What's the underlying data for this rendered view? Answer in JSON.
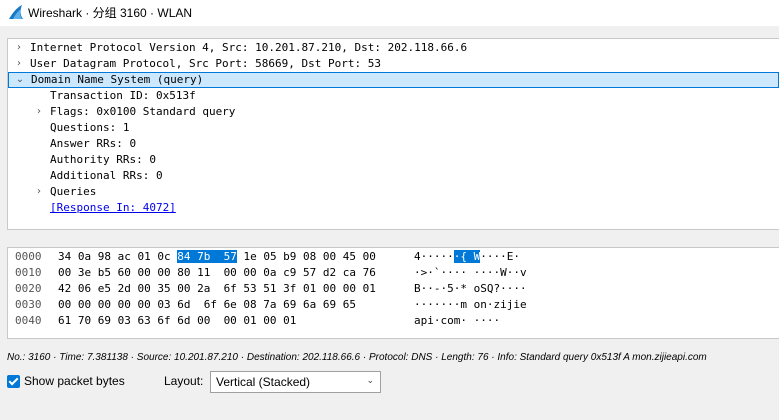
{
  "window": {
    "title": "Wireshark · 分组 3160 · WLAN",
    "icon": "wireshark-fin-icon",
    "accent_color": "#0078d7"
  },
  "tree": {
    "rows": [
      {
        "text": "Internet Protocol Version 4, Src: 10.201.87.210, Dst: 202.118.66.6",
        "toggle": "›",
        "depth": 0
      },
      {
        "text": "User Datagram Protocol, Src Port: 58669, Dst Port: 53",
        "toggle": "›",
        "depth": 0
      },
      {
        "text": "Domain Name System (query)",
        "toggle": "⌄",
        "depth": 0,
        "selected": true
      },
      {
        "text": "Transaction ID: 0x513f",
        "toggle": "",
        "depth": 1
      },
      {
        "text": "Flags: 0x0100 Standard query",
        "toggle": "›",
        "depth": 1
      },
      {
        "text": "Questions: 1",
        "toggle": "",
        "depth": 1
      },
      {
        "text": "Answer RRs: 0",
        "toggle": "",
        "depth": 1
      },
      {
        "text": "Authority RRs: 0",
        "toggle": "",
        "depth": 1
      },
      {
        "text": "Additional RRs: 0",
        "toggle": "",
        "depth": 1
      },
      {
        "text": "Queries",
        "toggle": "›",
        "depth": 1
      },
      {
        "text": "[Response In: 4072]",
        "toggle": "",
        "depth": 1,
        "link": true
      }
    ]
  },
  "hex": {
    "rows": [
      {
        "offset": "0000",
        "bytes_pre": "34 0a 98 ac 01 0c ",
        "bytes_hl": "84 7b  57",
        "bytes_post": " 1e 05 b9 08 00 45 00",
        "ascii_pre": "4·····",
        "ascii_hl": "·{ W",
        "ascii_post": "····E·"
      },
      {
        "offset": "0010",
        "bytes_pre": "00 3e b5 60 00 00 80 11  00 00 0a c9 57 d2 ca 76",
        "bytes_hl": "",
        "bytes_post": "",
        "ascii_pre": "·>·`···· ····W··v",
        "ascii_hl": "",
        "ascii_post": ""
      },
      {
        "offset": "0020",
        "bytes_pre": "42 06 e5 2d 00 35 00 2a  6f 53 51 3f 01 00 00 01",
        "bytes_hl": "",
        "bytes_post": "",
        "ascii_pre": "B··-·5·* oSQ?····",
        "ascii_hl": "",
        "ascii_post": ""
      },
      {
        "offset": "0030",
        "bytes_pre": "00 00 00 00 00 03 6d  6f 6e 08 7a 69 6a 69 65",
        "bytes_hl": "",
        "bytes_post": "",
        "ascii_pre": "·······m on·zijie",
        "ascii_hl": "",
        "ascii_post": ""
      },
      {
        "offset": "0040",
        "bytes_pre": "61 70 69 03 63 6f 6d 00  00 01 00 01",
        "bytes_hl": "",
        "bytes_post": "",
        "ascii_pre": "api·com· ····",
        "ascii_hl": "",
        "ascii_post": ""
      }
    ]
  },
  "status": {
    "text": "No.: 3160 · Time: 7.381138 · Source: 10.201.87.210 · Destination: 202.118.66.6 · Protocol: DNS · Length: 76 · Info: Standard query 0x513f A mon.zijieapi.com"
  },
  "bottom": {
    "show_packet_bytes_label": "Show packet bytes",
    "show_packet_bytes_checked": true,
    "layout_label": "Layout:",
    "layout_value": "Vertical (Stacked)"
  }
}
